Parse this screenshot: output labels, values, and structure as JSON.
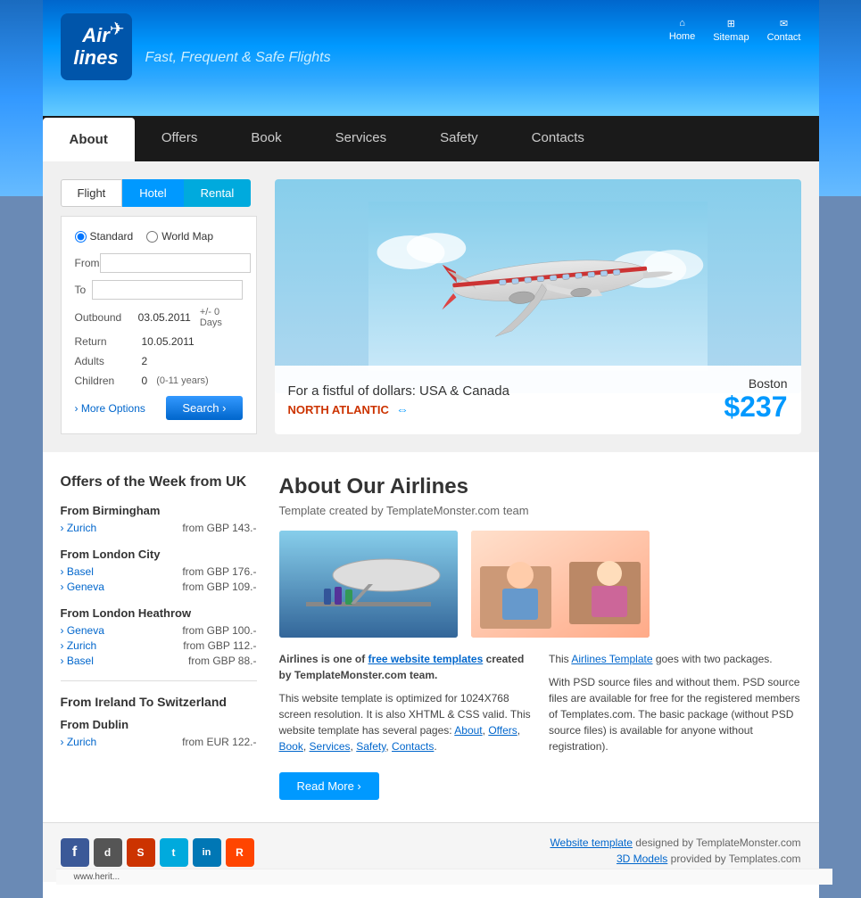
{
  "site": {
    "name": "Air lines",
    "tagline": "Fast, Frequent & Safe Flights"
  },
  "header_nav": {
    "home": "Home",
    "sitemap": "Sitemap",
    "contact": "Contact"
  },
  "main_nav": {
    "items": [
      {
        "label": "About",
        "active": true
      },
      {
        "label": "Offers",
        "active": false
      },
      {
        "label": "Book",
        "active": false
      },
      {
        "label": "Services",
        "active": false
      },
      {
        "label": "Safety",
        "active": false
      },
      {
        "label": "Contacts",
        "active": false
      }
    ]
  },
  "search": {
    "tabs": [
      "Flight",
      "Hotel",
      "Rental"
    ],
    "active_tab": "Hotel",
    "options": [
      "Standard",
      "World Map"
    ],
    "fields": {
      "from_label": "From",
      "to_label": "To",
      "outbound_label": "Outbound",
      "outbound_value": "03.05.2011",
      "outbound_extra": "+/- 0 Days",
      "return_label": "Return",
      "return_value": "10.05.2011",
      "adults_label": "Adults",
      "adults_value": "2",
      "children_label": "Children",
      "children_value": "0",
      "children_note": "(0-11 years)"
    },
    "more_options_label": "More Options",
    "search_button_label": "Search"
  },
  "hero": {
    "title": "For a fistful of dollars: USA & Canada",
    "route": "NORTH ATLANTIC",
    "city": "Boston",
    "price": "$237"
  },
  "offers": {
    "section_title": "Offers of the Week from UK",
    "groups": [
      {
        "title": "From Birmingham",
        "items": [
          {
            "destination": "Zurich",
            "price": "from GBP 143.-"
          }
        ]
      },
      {
        "title": "From London City",
        "items": [
          {
            "destination": "Basel",
            "price": "from GBP 176.-"
          },
          {
            "destination": "Geneva",
            "price": "from GBP 109.-"
          }
        ]
      },
      {
        "title": "From London Heathrow",
        "items": [
          {
            "destination": "Geneva",
            "price": "from GBP 100.-"
          },
          {
            "destination": "Zurich",
            "price": "from GBP 112.-"
          },
          {
            "destination": "Basel",
            "price": "from GBP 88.-"
          }
        ]
      }
    ],
    "region_title": "From Ireland To Switzerland",
    "region_groups": [
      {
        "title": "From Dublin",
        "items": [
          {
            "destination": "Zurich",
            "price": "from EUR 122.-"
          }
        ]
      }
    ]
  },
  "about": {
    "title": "About Our Airlines",
    "subtitle": "Template created by TemplateMonster.com team",
    "col1": {
      "bold_text": "Airlines is one of",
      "link1_text": "free website templates",
      "link1_cont": "created by TemplateMonster.com team.",
      "body": "This website template is optimized for 1024X768 screen resolution. It is also XHTML & CSS valid. This website template has several pages:",
      "links": [
        "About",
        "Offers",
        "Book",
        "Services",
        "Safety",
        "Contacts"
      ]
    },
    "col2": {
      "bold_text": "This",
      "link_text": "Airlines Template",
      "link_cont": "goes with two packages.",
      "body": "With PSD source files and without them. PSD source files are available for free for the registered members of Templates.com. The basic package (without PSD source files) is available for anyone without registration)."
    },
    "read_more_label": "Read More"
  },
  "footer": {
    "social_icons": [
      "f",
      "d",
      "S",
      "t",
      "in",
      "R"
    ],
    "credit1_text": "Website template",
    "credit1_cont": "designed by TemplateMonster.com",
    "credit2_text": "3D Models",
    "credit2_cont": "provided by Templates.com",
    "url": "www.herit..."
  }
}
